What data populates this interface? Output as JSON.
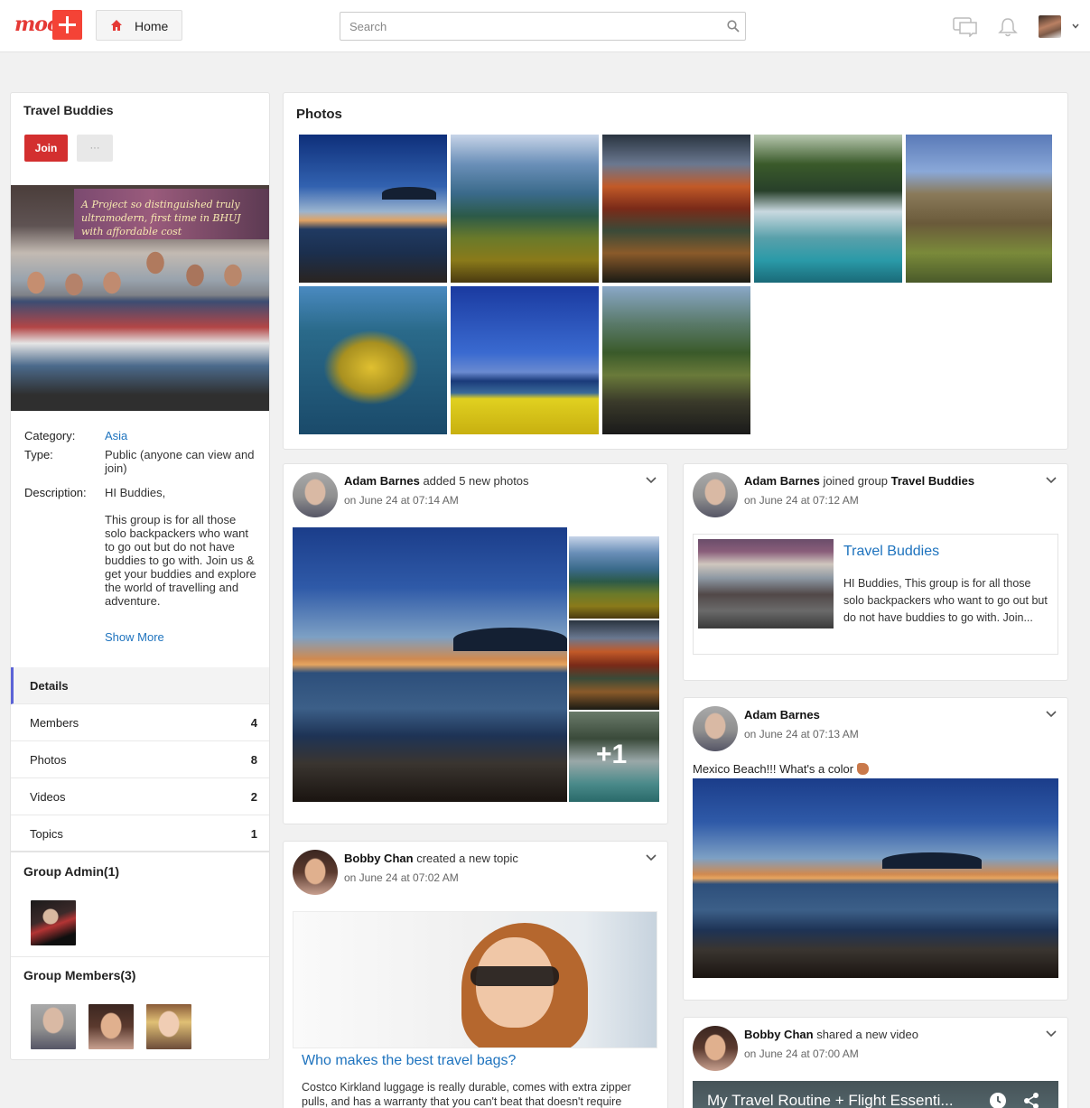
{
  "nav": {
    "logo_text": "moo",
    "home_label": "Home",
    "search_placeholder": "Search"
  },
  "group": {
    "title": "Travel Buddies",
    "join_label": "Join",
    "more_label": "···",
    "cover_text": "A Project so distinguished truly ultramodern, first time in BHUJ with affordable cost",
    "category_label": "Category:",
    "category_value": "Asia",
    "type_label": "Type:",
    "type_value": "Public (anyone can view and join)",
    "description_label": "Description:",
    "description_greeting": "HI Buddies,",
    "description_body": "This group is for all those solo backpackers who want to go out but do not have buddies to go with. Join us & get your buddies and explore the world of travelling and adventure.",
    "show_more": "Show More",
    "nav_items": [
      {
        "label": "Details",
        "count": ""
      },
      {
        "label": "Members",
        "count": "4"
      },
      {
        "label": "Photos",
        "count": "8"
      },
      {
        "label": "Videos",
        "count": "2"
      },
      {
        "label": "Topics",
        "count": "1"
      }
    ],
    "admin_title": "Group Admin(1)",
    "members_title": "Group Members(3)"
  },
  "photos": {
    "title": "Photos"
  },
  "feed": {
    "post1": {
      "author": "Adam Barnes",
      "action": "added 5 new photos",
      "time": "on June 24 at 07:14 AM",
      "more_count": "+1"
    },
    "post2": {
      "author": "Bobby Chan",
      "action": "created a new topic",
      "time": "on June 24 at 07:02 AM",
      "topic_title": "Who makes the best travel bags?",
      "topic_desc": "Costco Kirkland luggage is really durable, comes with extra zipper pulls, and has a warranty that you can't beat that doesn't require"
    },
    "post3": {
      "author": "Adam Barnes",
      "action": "joined group",
      "target": "Travel Buddies",
      "time": "on June 24 at 07:12 AM",
      "link_title": "Travel Buddies",
      "link_desc": "HI Buddies, This group is for all those solo backpackers who want to go out but do not have buddies to go with. Join..."
    },
    "post4": {
      "author": "Adam Barnes",
      "time": "on June 24 at 07:13 AM",
      "status": "Mexico Beach!!! What's a color"
    },
    "post5": {
      "author": "Bobby Chan",
      "action": "shared a new video",
      "time": "on June 24 at 07:00 AM",
      "video_title": "My Travel Routine + Flight Essenti..."
    }
  }
}
